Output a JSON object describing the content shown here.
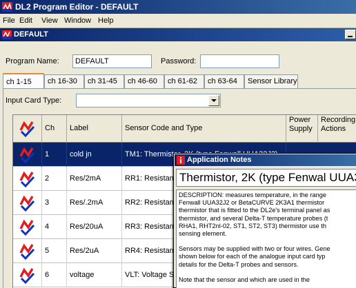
{
  "app": {
    "title": "DL2 Program Editor - DEFAULT"
  },
  "menu": [
    "File",
    "Edit",
    "View",
    "Window",
    "Help"
  ],
  "child": {
    "title": "DEFAULT",
    "program_name_label": "Program Name:",
    "program_name_value": "DEFAULT",
    "password_label": "Password:",
    "password_value": "",
    "tabs": [
      "ch 1-15",
      "ch 16-30",
      "ch 31-45",
      "ch 46-60",
      "ch 61-62",
      "ch 63-64",
      "Sensor Library"
    ],
    "active_tab": 0,
    "input_card_label": "Input Card Type:",
    "input_card_value": ""
  },
  "grid": {
    "headers": [
      "Ch",
      "Label",
      "Sensor Code and Type",
      "Power Supply",
      "Recording Actions"
    ],
    "rows": [
      {
        "ch": "1",
        "label": "cold jn",
        "sensor": "TM1: Thermistor, 2K (type Fenwall UUA32J2)",
        "selected": true
      },
      {
        "ch": "2",
        "label": "Res/2mA",
        "sensor": "RR1: Resistance S",
        "selected": false
      },
      {
        "ch": "3",
        "label": "Res/.2mA",
        "sensor": "RR2: Resistance S",
        "selected": false
      },
      {
        "ch": "4",
        "label": "Res/20uA",
        "sensor": "RR3: Resistance S",
        "selected": false
      },
      {
        "ch": "5",
        "label": "Res/2uA",
        "sensor": "RR4: Resistance S",
        "selected": false
      },
      {
        "ch": "6",
        "label": "voltage",
        "sensor": "VLT: Voltage Sens",
        "selected": false
      }
    ]
  },
  "notes": {
    "title": "Application Notes",
    "heading": "Thermistor, 2K (type Fenwal UUA32J2)",
    "paragraphs": [
      [
        "DESCRIPTION: measures temperature, in the range",
        "Fenwall UUA32J2 or BetaCURVE 2K3A1 thermistor",
        "thermistor that is fitted to the DL2e's terminal panel as",
        "thermistor, and several Delta-T temperature probes (t",
        "RHA1, RHT2nl-02, ST1, ST2, ST3) thermistor use th",
        "sensing element."
      ],
      [
        "Sensors may be supplied with two or four wires. Gene",
        "shown below for each of the analogue input card typ",
        "details for the Delta-T probes and sensors."
      ],
      [
        "Note that the sensor and which are used in the"
      ]
    ]
  },
  "colors": {
    "title_blue": "#0a246a",
    "selection": "#0a246a",
    "sensor_icon_red": "#e02020",
    "check_blue": "#1030c0"
  },
  "icons": {
    "app": "dl2-logger-icon",
    "sensor_row": "sensor-check-icon",
    "notes": "info-icon"
  }
}
